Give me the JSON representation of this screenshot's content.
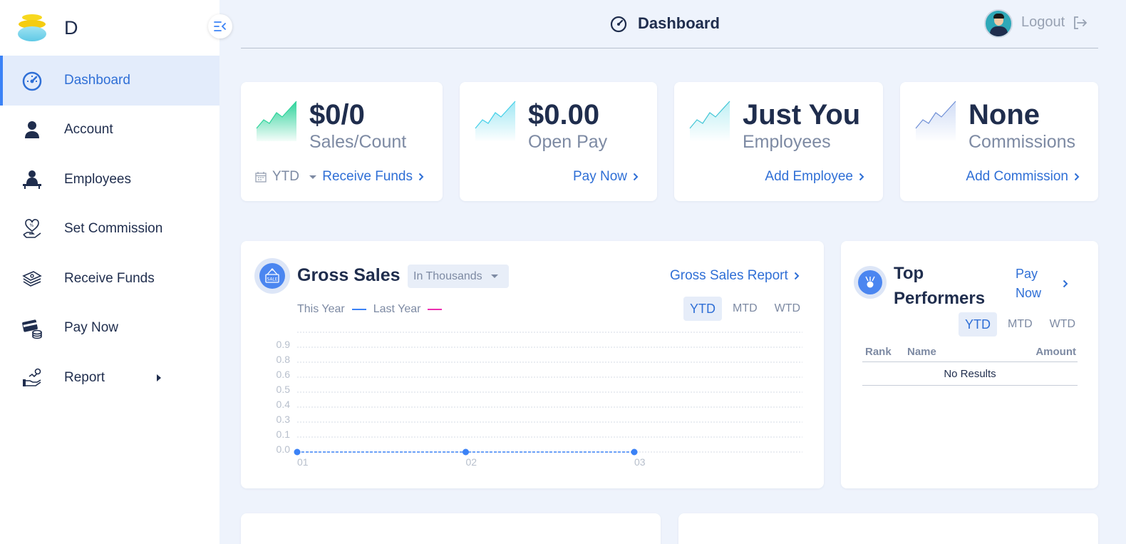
{
  "brand": {
    "name": "D"
  },
  "header": {
    "title": "Dashboard",
    "logout": "Logout"
  },
  "sidebar": {
    "items": [
      {
        "label": "Dashboard",
        "icon": "dashboard-gauge-icon",
        "active": true
      },
      {
        "label": "Account",
        "icon": "user-icon"
      },
      {
        "label": "Employees",
        "icon": "employee-desk-icon"
      },
      {
        "label": "Set Commission",
        "icon": "heart-hand-percent-icon"
      },
      {
        "label": "Receive Funds",
        "icon": "money-stack-icon"
      },
      {
        "label": "Pay Now",
        "icon": "card-coins-icon"
      },
      {
        "label": "Report",
        "icon": "hand-chart-icon",
        "has_submenu": true
      }
    ]
  },
  "stats": [
    {
      "value": "$0/0",
      "label": "Sales/Count",
      "period": "YTD",
      "link": "Receive Funds"
    },
    {
      "value": "$0.00",
      "label": "Open Pay",
      "link": "Pay Now"
    },
    {
      "value": "Just You",
      "label": "Employees",
      "link": "Add Employee"
    },
    {
      "value": "None",
      "label": "Commissions",
      "link": "Add Commission"
    }
  ],
  "gross_sales": {
    "title": "Gross Sales",
    "unit_select": "In Thousands",
    "report_link": "Gross Sales Report",
    "legend": {
      "this_year": "This Year",
      "last_year": "Last Year"
    },
    "periods": [
      "YTD",
      "MTD",
      "WTD"
    ],
    "active_period": "YTD",
    "colors": {
      "this_year": "#3b82f6",
      "last_year": "#ec2fb0"
    }
  },
  "chart_data": {
    "type": "line",
    "title": "Gross Sales",
    "x": [
      "01",
      "02",
      "03"
    ],
    "series": [
      {
        "name": "This Year",
        "values": [
          0,
          0,
          0
        ]
      }
    ],
    "yticks": [
      "0.0",
      "0.1",
      "0.3",
      "0.4",
      "0.5",
      "0.6",
      "0.8",
      "0.9"
    ],
    "ylim": [
      0,
      1
    ],
    "grid": true,
    "legend": "top-left"
  },
  "top_performers": {
    "title_line1": "Top",
    "title_line2": "Performers",
    "link_line1": "Pay",
    "link_line2": "Now",
    "periods": [
      "YTD",
      "MTD",
      "WTD"
    ],
    "active_period": "YTD",
    "columns": [
      "Rank",
      "Name",
      "Amount"
    ],
    "empty_text": "No Results"
  }
}
